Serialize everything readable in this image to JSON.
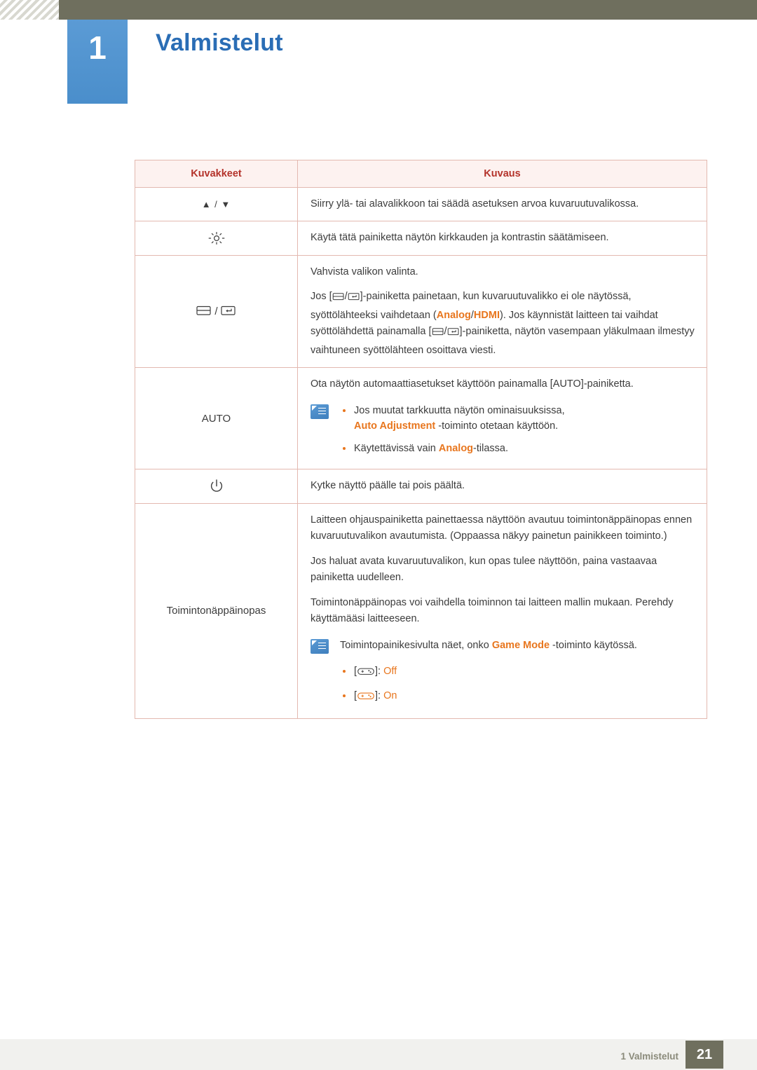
{
  "header": {
    "chapter_number": "1",
    "chapter_title": "Valmistelut"
  },
  "table": {
    "columns": [
      "Kuvakkeet",
      "Kuvaus"
    ],
    "rows": [
      {
        "icon_name": "up-down-arrows-icon",
        "icon_label": "▲ / ▼",
        "paragraphs": [
          "Siirry ylä- tai alavalikkoon tai säädä asetuksen arvoa kuvaruutuvalikossa."
        ]
      },
      {
        "icon_name": "brightness-sun-icon",
        "icon_label": "",
        "paragraphs": [
          "Käytä tätä painiketta näytön kirkkauden ja kontrastin säätämiseen."
        ]
      },
      {
        "icon_name": "source-enter-icon",
        "icon_label": "/",
        "paragraphs": [
          "Vahvista valikon valinta.",
          "Jos [  /  ]-painiketta painetaan, kun kuvaruutuvalikko ei ole näytössä, syöttölähteeksi vaihdetaan (Analog/HDMI). Jos käynnistät laitteen tai vaihdat syöttölähdettä painamalla [  /  ]-painiketta, näytön vasempaan yläkulmaan ilmestyy vaihtuneen syöttölähteen osoittava viesti."
        ],
        "inline_orange": [
          "Analog",
          "HDMI"
        ]
      },
      {
        "icon_name": "auto-button-icon",
        "icon_label": "AUTO",
        "paragraphs": [
          "Ota näytön automaattiasetukset käyttöön painamalla [AUTO]-painiketta."
        ],
        "note_bullets": [
          "Jos muutat tarkkuutta näytön ominaisuuksissa, Auto Adjustment -toiminto otetaan käyttöön.",
          "Käytettävissä vain Analog-tilassa."
        ],
        "note_bullet_1_pre": "Jos muutat tarkkuutta näytön ominaisuuksissa,",
        "note_bullet_1_orange": "Auto Adjustment",
        "note_bullet_1_post": "-toiminto otetaan käyttöön.",
        "note_bullet_2_pre": "Käytettävissä vain",
        "note_bullet_2_orange": "Analog",
        "note_bullet_2_post": "-tilassa."
      },
      {
        "icon_name": "power-button-icon",
        "icon_label": "",
        "paragraphs": [
          "Kytke näyttö päälle tai pois päältä."
        ]
      },
      {
        "icon_name": "function-key-guide-label",
        "icon_label": "Toimintonäppäinopas",
        "paragraphs": [
          "Laitteen ohjauspainiketta painettaessa näyttöön avautuu toimintonäppäinopas ennen kuvaruutuvalikon avautumista. (Oppaassa näkyy painetun painikkeen toiminto.)",
          "Jos haluat avata kuvaruutuvalikon, kun opas tulee näyttöön, paina vastaavaa painiketta uudelleen.",
          "Toimintonäppäinopas voi vaihdella toiminnon tai laitteen mallin mukaan. Perehdy käyttämääsi laitteeseen."
        ],
        "note_text_pre": "Toimintopainikesivulta näet, onko",
        "note_text_orange": "Game Mode",
        "note_text_post": "-toiminto käytössä.",
        "game_bullets": [
          {
            "icon_name": "gamepad-off-icon",
            "bracket_open": "[",
            "bracket_close": "]:",
            "state": "Off"
          },
          {
            "icon_name": "gamepad-on-icon",
            "bracket_open": "[",
            "bracket_close": "]:",
            "state": "On"
          }
        ]
      }
    ]
  },
  "footer": {
    "text": "1 Valmistelut",
    "page_number": "21"
  },
  "colors": {
    "accent_blue": "#2a6db5",
    "accent_orange": "#e8761e",
    "table_border": "#e3b9b0",
    "header_bar": "#6f6f5e",
    "header_row_bg": "#fdf2f0",
    "header_row_text": "#b4332b"
  }
}
